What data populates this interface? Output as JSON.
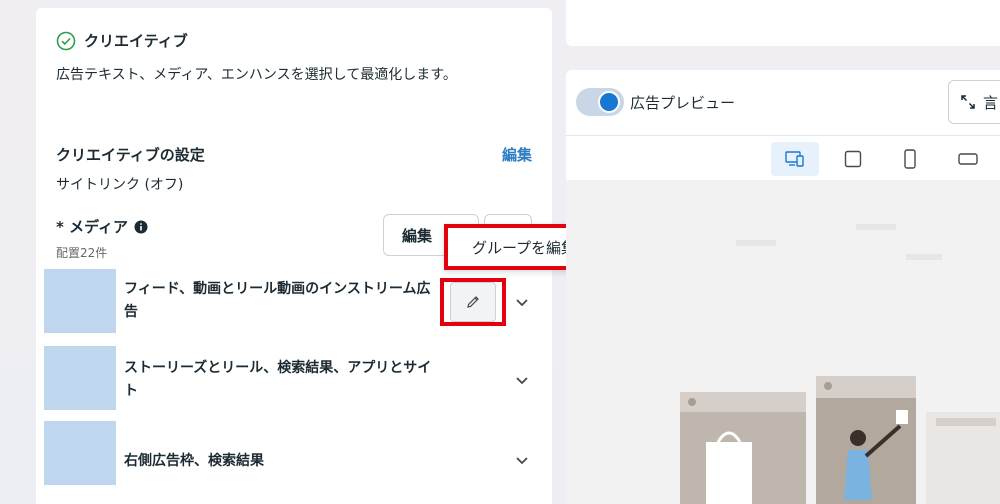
{
  "creative": {
    "title": "クリエイティブ",
    "description": "広告テキスト、メディア、エンハンスを選択して最適化します。",
    "settings_label": "クリエイティブの設定",
    "settings_edit": "編集",
    "settings_value": "サイトリンク (オフ)",
    "media_label": "* メディア",
    "media_count": "配置22件",
    "media_edit_button": "編集",
    "placements": [
      {
        "title": "フィード、動画とリール動画のインストリーム広告"
      },
      {
        "title": "ストーリーズとリール、検索結果、アプリとサイト"
      },
      {
        "title": "右側広告枠、検索結果"
      }
    ]
  },
  "tooltip": {
    "text": "グループを編集"
  },
  "preview": {
    "toggle_label": "広告プレビュー",
    "expand_label": "言"
  },
  "icons": {
    "check": "check-circle-icon",
    "info": "info-icon",
    "pencil": "pencil-icon",
    "chevron": "chevron-down-icon",
    "expand": "expand-icon",
    "devices": [
      "multi-device-icon",
      "square-icon",
      "phone-vertical-icon",
      "phone-horizontal-icon"
    ]
  },
  "colors": {
    "accent": "#1877d2",
    "link": "#2d7dc1",
    "highlight": "#e3000f",
    "thumbnail": "#bfd7ee"
  }
}
